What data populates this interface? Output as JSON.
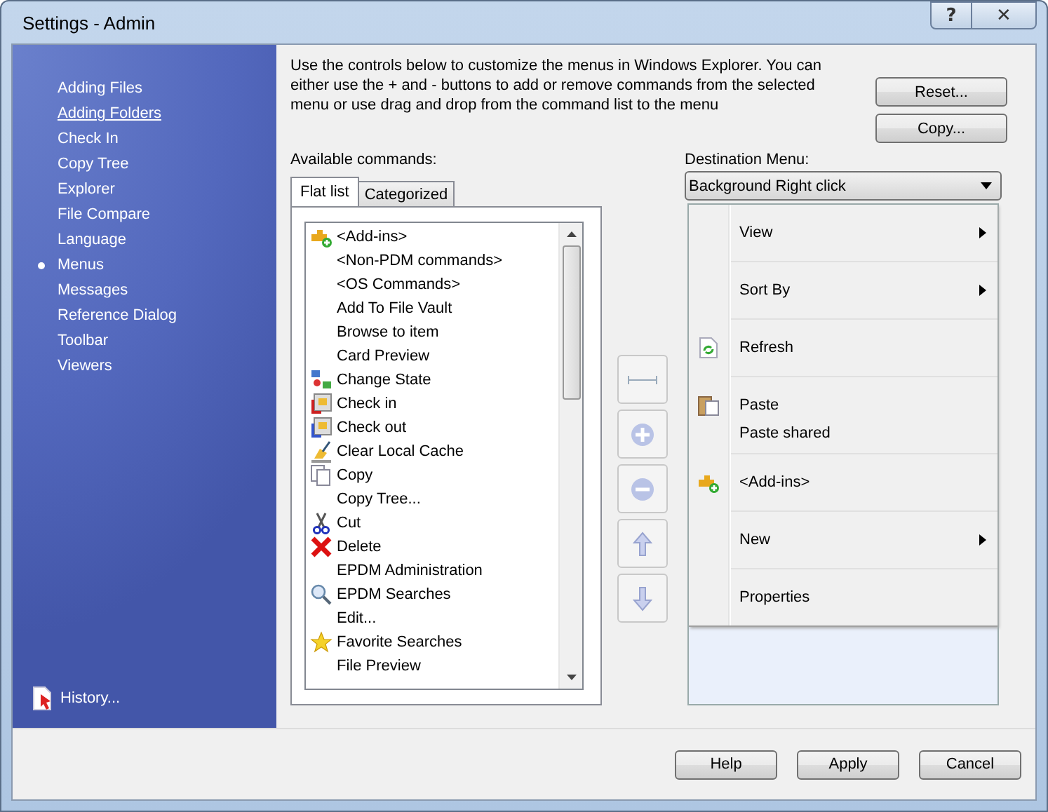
{
  "window": {
    "title": "Settings - Admin",
    "help_button": "?",
    "close_button": "✕"
  },
  "sidebar": {
    "items": [
      {
        "label": "Adding Files",
        "selected": false,
        "hovered": false
      },
      {
        "label": "Adding Folders",
        "selected": false,
        "hovered": true
      },
      {
        "label": "Check In",
        "selected": false,
        "hovered": false
      },
      {
        "label": "Copy Tree",
        "selected": false,
        "hovered": false
      },
      {
        "label": "Explorer",
        "selected": false,
        "hovered": false
      },
      {
        "label": "File Compare",
        "selected": false,
        "hovered": false
      },
      {
        "label": "Language",
        "selected": false,
        "hovered": false
      },
      {
        "label": "Menus",
        "selected": true,
        "hovered": false
      },
      {
        "label": "Messages",
        "selected": false,
        "hovered": false
      },
      {
        "label": "Reference Dialog",
        "selected": false,
        "hovered": false
      },
      {
        "label": "Toolbar",
        "selected": false,
        "hovered": false
      },
      {
        "label": "Viewers",
        "selected": false,
        "hovered": false
      }
    ],
    "history_link": "History..."
  },
  "description": "Use the controls below to customize the menus in Windows Explorer. You can either use the + and - buttons to add or remove commands from the selected menu or use drag and drop from the command list to the menu",
  "reset_button": "Reset...",
  "copy_button": "Copy...",
  "available_commands": {
    "label": "Available commands:",
    "tabs": [
      {
        "label": "Flat list",
        "selected": true
      },
      {
        "label": "Categorized",
        "selected": false
      }
    ],
    "items": [
      {
        "label": "<Add-ins>",
        "kind": "addin"
      },
      {
        "label": "<Non-PDM commands>",
        "kind": "plain"
      },
      {
        "label": "<OS Commands>",
        "kind": "plain"
      },
      {
        "label": "Add To File Vault",
        "kind": "plain"
      },
      {
        "label": "Browse to item",
        "kind": "plain"
      },
      {
        "label": "Card Preview",
        "kind": "plain"
      },
      {
        "label": "Change State",
        "kind": "state"
      },
      {
        "label": "Check in",
        "kind": "checkin"
      },
      {
        "label": "Check out",
        "kind": "checkout"
      },
      {
        "label": "Clear Local Cache",
        "kind": "cache"
      },
      {
        "label": "Copy",
        "kind": "copy"
      },
      {
        "label": "Copy Tree...",
        "kind": "plain"
      },
      {
        "label": "Cut",
        "kind": "cut"
      },
      {
        "label": "Delete",
        "kind": "delete"
      },
      {
        "label": "EPDM Administration",
        "kind": "plain"
      },
      {
        "label": "EPDM Searches",
        "kind": "search"
      },
      {
        "label": "Edit...",
        "kind": "plain"
      },
      {
        "label": "Favorite Searches",
        "kind": "star"
      },
      {
        "label": "File Preview",
        "kind": "plain"
      }
    ]
  },
  "move_buttons": [
    {
      "kind": "separator",
      "disabled": true
    },
    {
      "kind": "add",
      "disabled": true
    },
    {
      "kind": "remove",
      "disabled": true
    },
    {
      "kind": "up",
      "disabled": true
    },
    {
      "kind": "down",
      "disabled": true
    }
  ],
  "destination": {
    "label": "Destination Menu:",
    "value": "Background Right click",
    "groups": [
      [
        {
          "label": "View",
          "kind": "plain",
          "submenu": true
        }
      ],
      [
        {
          "label": "Sort By",
          "kind": "plain",
          "submenu": true
        }
      ],
      [
        {
          "label": "Refresh",
          "kind": "refresh",
          "submenu": false
        }
      ],
      [
        {
          "label": "Paste",
          "kind": "paste",
          "submenu": false
        },
        {
          "label": "Paste shared",
          "kind": "plain",
          "submenu": false
        }
      ],
      [
        {
          "label": "<Add-ins>",
          "kind": "addin",
          "submenu": false
        }
      ],
      [
        {
          "label": "New",
          "kind": "plain",
          "submenu": true
        }
      ],
      [
        {
          "label": "Properties",
          "kind": "plain",
          "submenu": false
        }
      ]
    ]
  },
  "footer_buttons": [
    "Help",
    "Apply",
    "Cancel"
  ]
}
